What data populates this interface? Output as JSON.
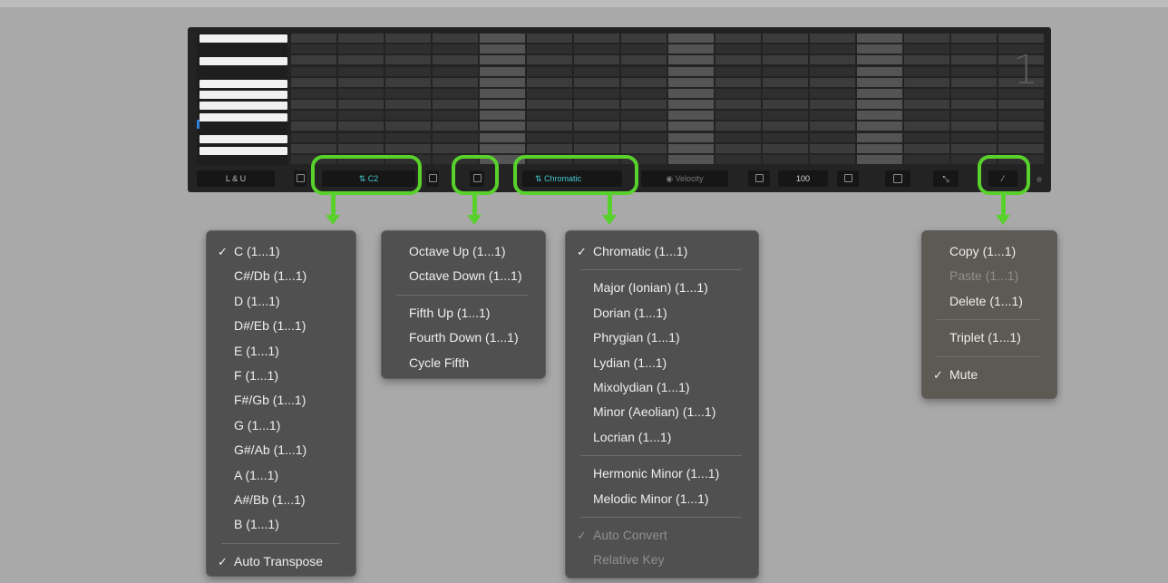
{
  "sequencer": {
    "pattern_number": "1",
    "controls": {
      "track_label": "L & U",
      "root_note": "C2",
      "scale": "Chromatic",
      "velocity_label": "Velocity",
      "velocity_value": "100"
    }
  },
  "menus": {
    "key_menu": {
      "items": [
        {
          "label": "C (1...1)",
          "checked": true
        },
        {
          "label": "C#/Db (1...1)"
        },
        {
          "label": "D (1...1)"
        },
        {
          "label": "D#/Eb (1...1)"
        },
        {
          "label": "E (1...1)"
        },
        {
          "label": "F (1...1)"
        },
        {
          "label": "F#/Gb (1...1)"
        },
        {
          "label": "G (1...1)"
        },
        {
          "label": "G#/Ab (1...1)"
        },
        {
          "label": "A (1...1)"
        },
        {
          "label": "A#/Bb (1...1)"
        },
        {
          "label": "B (1...1)"
        }
      ],
      "footer": {
        "label": "Auto Transpose",
        "checked": true
      }
    },
    "transpose_menu": {
      "group1": [
        "Octave Up (1...1)",
        "Octave Down (1...1)"
      ],
      "group2": [
        "Fifth Up (1...1)",
        "Fourth Down (1...1)",
        "Cycle Fifth"
      ]
    },
    "scale_menu": {
      "top": {
        "label": "Chromatic (1...1)",
        "checked": true
      },
      "modes": [
        "Major (Ionian) (1...1)",
        "Dorian (1...1)",
        "Phrygian (1...1)",
        "Lydian (1...1)",
        "Mixolydian (1...1)",
        "Minor (Aeolian) (1...1)",
        "Locrian (1...1)"
      ],
      "minors": [
        "Hermonic Minor (1...1)",
        "Melodic Minor (1...1)"
      ],
      "options": [
        {
          "label": "Auto Convert",
          "checked": true,
          "disabled": true
        },
        {
          "label": "Relative Key",
          "disabled": true
        }
      ]
    },
    "edit_menu": {
      "group1": [
        {
          "label": "Copy (1...1)"
        },
        {
          "label": "Paste (1...1)",
          "disabled": true
        },
        {
          "label": "Delete (1...1)"
        }
      ],
      "group2": [
        "Triplet (1...1)"
      ],
      "group3": {
        "label": "Mute",
        "checked": true
      }
    }
  },
  "colors": {
    "callout": "#58d12c",
    "accent_text": "#46c8cf",
    "background": "#a9a9a9",
    "panel": "#232323",
    "menu": "#505050"
  }
}
